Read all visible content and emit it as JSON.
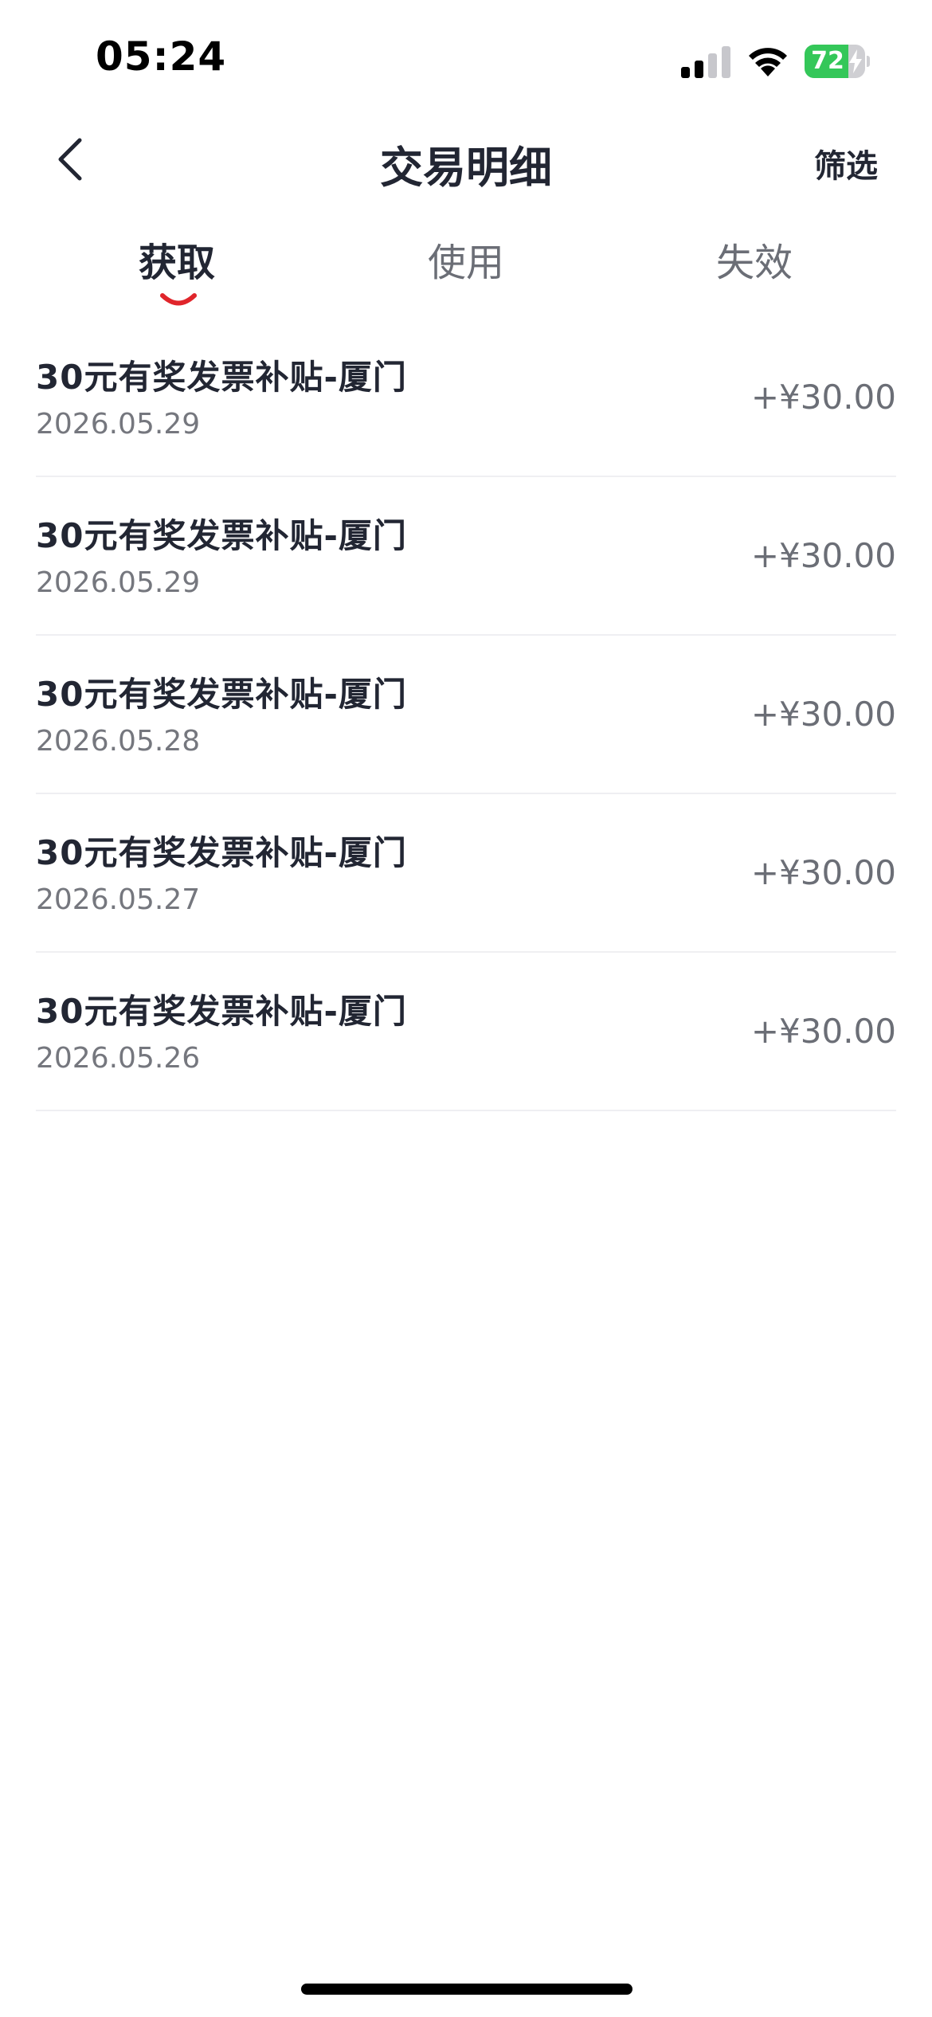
{
  "status_bar": {
    "time": "05:24",
    "battery_level": "72",
    "battery_fraction": 0.72,
    "signal_icon": "cellular-signal-icon",
    "wifi_icon": "wifi-icon",
    "charging_icon": "bolt-icon"
  },
  "nav": {
    "title": "交易明细",
    "filter_label": "筛选",
    "back_icon": "chevron-left-icon"
  },
  "tabs": [
    {
      "label": "获取",
      "active": true
    },
    {
      "label": "使用",
      "active": false
    },
    {
      "label": "失效",
      "active": false
    }
  ],
  "accent_color": "#e0252b",
  "transactions": [
    {
      "title": "30元有奖发票补贴-厦门",
      "date": "2026.05.29",
      "amount": "+¥30.00"
    },
    {
      "title": "30元有奖发票补贴-厦门",
      "date": "2026.05.29",
      "amount": "+¥30.00"
    },
    {
      "title": "30元有奖发票补贴-厦门",
      "date": "2026.05.28",
      "amount": "+¥30.00"
    },
    {
      "title": "30元有奖发票补贴-厦门",
      "date": "2026.05.27",
      "amount": "+¥30.00"
    },
    {
      "title": "30元有奖发票补贴-厦门",
      "date": "2026.05.26",
      "amount": "+¥30.00"
    }
  ]
}
